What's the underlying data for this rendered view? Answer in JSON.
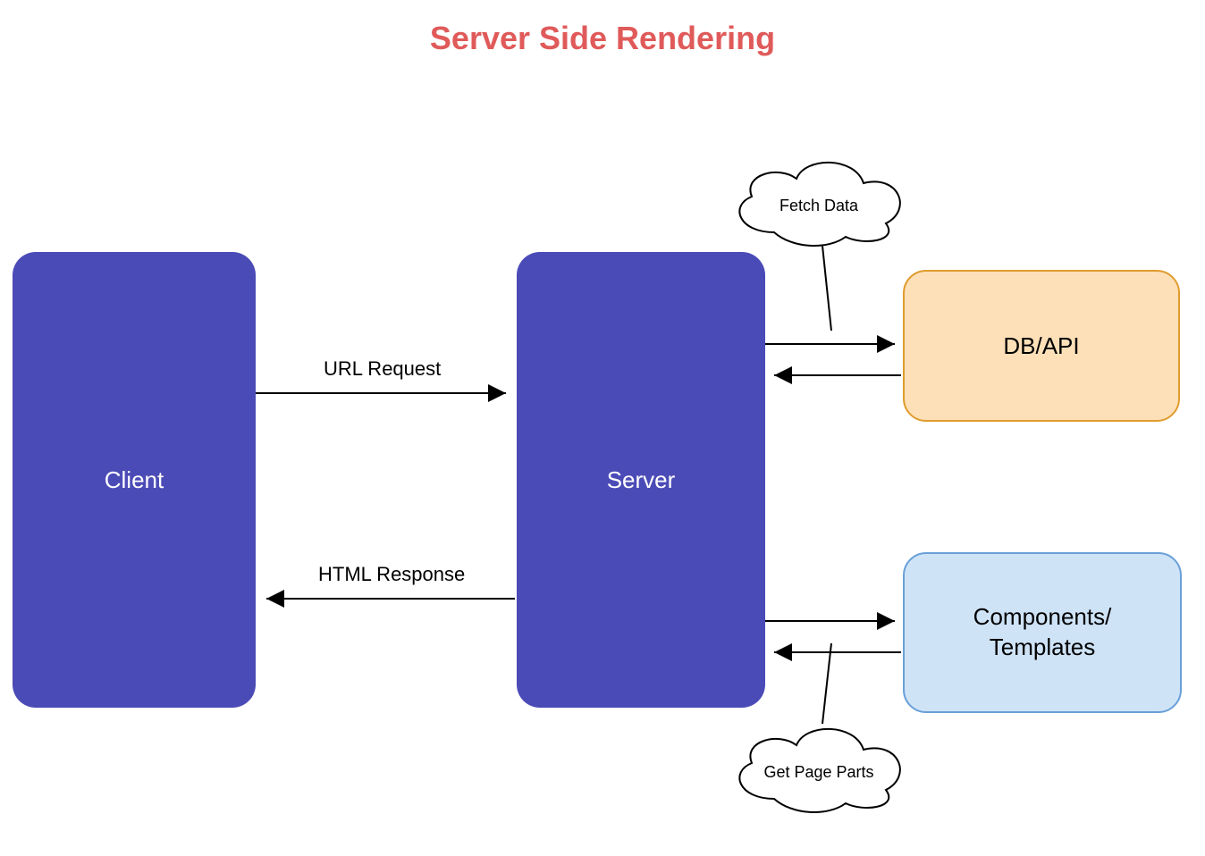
{
  "title": "Server Side Rendering",
  "nodes": {
    "client": "Client",
    "server": "Server",
    "dbapi": "DB/API",
    "components_line1": "Components/",
    "components_line2": "Templates"
  },
  "clouds": {
    "fetch_data": "Fetch Data",
    "get_page_parts": "Get Page Parts"
  },
  "edges": {
    "url_request": "URL Request",
    "html_response": "HTML Response"
  },
  "colors": {
    "title": "#e05a5a",
    "primary_box": "#4b4bb7",
    "dbapi_fill": "#fde0b8",
    "dbapi_border": "#e09c2e",
    "components_fill": "#cfe3f7",
    "components_border": "#6aa0d8"
  }
}
